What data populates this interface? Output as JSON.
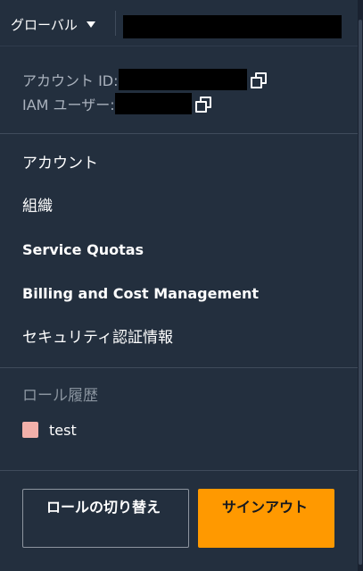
{
  "header": {
    "region_label": "グローバル",
    "region_caret_icon": "caret-down-icon"
  },
  "account_info": {
    "account_id_label": "アカウント ID:",
    "iam_user_label": "IAM ユーザー:",
    "copy_icon": "copy-icon"
  },
  "menu": {
    "items": [
      {
        "label": "アカウント"
      },
      {
        "label": "組織"
      },
      {
        "label": "Service Quotas"
      },
      {
        "label": "Billing and Cost Management"
      },
      {
        "label": "セキュリティ認証情報"
      }
    ]
  },
  "role_history": {
    "heading": "ロール履歴",
    "roles": [
      {
        "label": "test",
        "color": "#f2b0aa"
      }
    ]
  },
  "actions": {
    "switch_role_label": "ロールの切り替え",
    "sign_out_label": "サインアウト"
  },
  "colors": {
    "background": "#232f3e",
    "primary_button": "#ff9900",
    "redaction": "#000000"
  }
}
